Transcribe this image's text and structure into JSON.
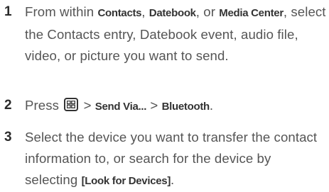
{
  "steps": [
    {
      "number": "1",
      "parts": {
        "t1": "From within ",
        "k1": "Contacts",
        "t2": ", ",
        "k2": "Datebook",
        "t3": ", or ",
        "k3": "Media Center",
        "t4": ", select the Contacts entry, Datebook event, audio file, video, or picture you want to send."
      }
    },
    {
      "number": "2",
      "parts": {
        "t1": "Press ",
        "icon": "menu-key-icon",
        "t2": " > ",
        "k1": "Send Via...",
        "t3": " > ",
        "k2": "Bluetooth",
        "t4": "."
      }
    },
    {
      "number": "3",
      "parts": {
        "t1": "Select the device you want to transfer the contact information to, or search for the device by selecting ",
        "k1": "[Look for Devices]",
        "t2": "."
      }
    }
  ]
}
